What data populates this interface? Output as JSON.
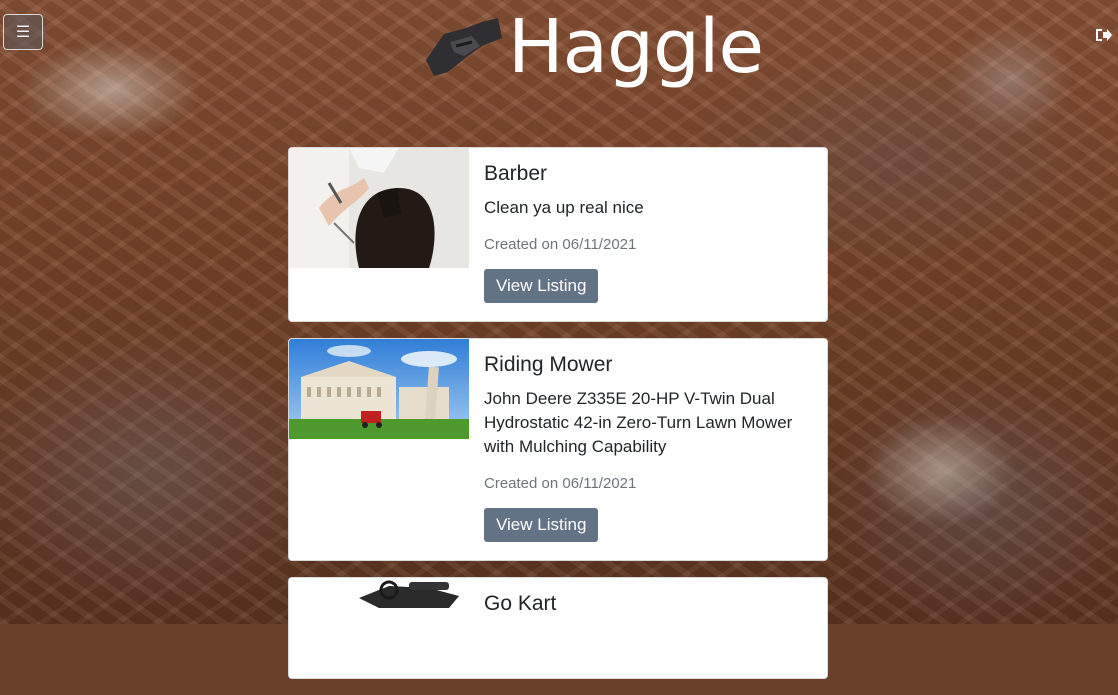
{
  "app": {
    "brand": "Haggle"
  },
  "header": {
    "menu_icon": "hamburger-icon",
    "logout_icon": "logout-icon",
    "logo_icon": "handshake-icon"
  },
  "listings": [
    {
      "title": "Barber",
      "description": "Clean ya up real nice",
      "created": "Created on 06/11/2021",
      "button": "View Listing"
    },
    {
      "title": "Riding Mower",
      "description": "John Deere Z335E 20-HP V-Twin Dual Hydrostatic 42-in Zero-Turn Lawn Mower with Mulching Capability",
      "created": "Created on 06/11/2021",
      "button": "View Listing"
    },
    {
      "title": "Go Kart",
      "description": "",
      "created": "",
      "button": ""
    }
  ],
  "colors": {
    "button": "#637386",
    "card": "#ffffff",
    "muted": "#6c757d"
  }
}
